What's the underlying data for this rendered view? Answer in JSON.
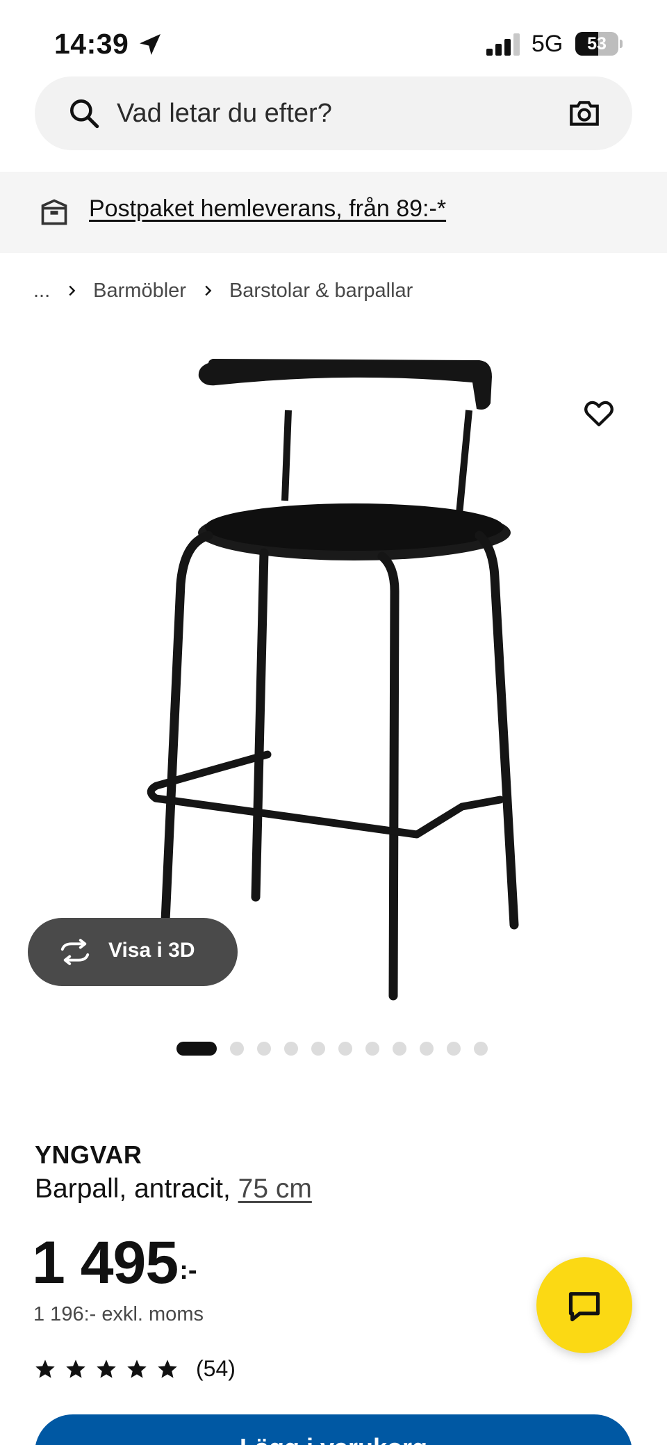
{
  "status_bar": {
    "time": "14:39",
    "network": "5G",
    "battery": "53",
    "battery_level": 0.53
  },
  "search": {
    "placeholder": "Vad letar du efter?",
    "value": ""
  },
  "delivery": {
    "text": "Postpaket hemleverans, från 89:-*"
  },
  "breadcrumb": {
    "ellipsis": "...",
    "items": [
      "Barmöbler",
      "Barstolar & barpallar"
    ]
  },
  "media": {
    "view_3d_label": "Visa i 3D",
    "image_count": 11,
    "active_index": 0
  },
  "product": {
    "name": "YNGVAR",
    "description": "Barpall, antracit, ",
    "size": "75 cm",
    "price": "1 495",
    "price_suffix": ":-",
    "price_ex_vat": "1 196:- exkl. moms",
    "rating": 5,
    "rating_count": "(54)"
  },
  "actions": {
    "cart_label": "Lägg i varukorg"
  },
  "icons": {
    "location": "location-arrow-icon",
    "signal": "signal-icon",
    "search": "search-icon",
    "camera": "camera-icon",
    "delivery": "parcel-icon",
    "chevron": "chevron-right-icon",
    "favorite": "heart-icon",
    "rotate": "rotate-3d-icon",
    "star": "star-icon",
    "chat": "chat-icon"
  },
  "colors": {
    "accent_blue": "#0058a3",
    "chat_yellow": "#fbd914",
    "pill_dark": "#4a4a4a"
  }
}
